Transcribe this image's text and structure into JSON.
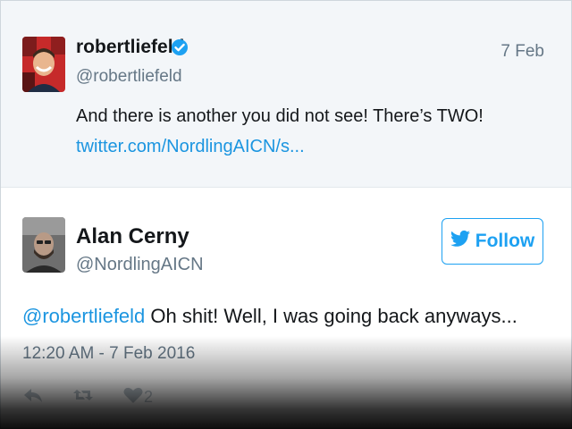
{
  "parent_tweet": {
    "name": "robertliefeld",
    "handle": "@robertliefeld",
    "verified_icon": "verified-badge-icon",
    "date": "7 Feb",
    "text": "And there is another you did not see! There’s TWO!",
    "link": "twitter.com/NordlingAICN/s..."
  },
  "reply_tweet": {
    "name": "Alan Cerny",
    "handle": "@NordlingAICN",
    "follow_label": "Follow",
    "mention": "@robertliefeld",
    "text": " Oh shit! Well, I was going back anyways...",
    "timestamp": "12:20 AM - 7 Feb 2016",
    "like_count": "2"
  },
  "colors": {
    "accent": "#1da1f2",
    "link": "#1b95e0",
    "muted": "#657786"
  }
}
